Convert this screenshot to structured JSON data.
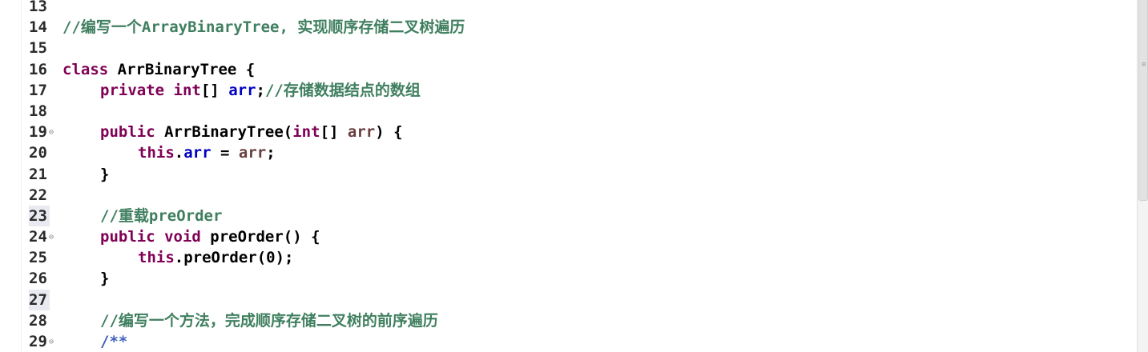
{
  "editor": {
    "lines": [
      {
        "num": "13",
        "tokens": []
      },
      {
        "num": "14",
        "tokens": [
          {
            "t": "//编写一个ArrayBinaryTree, 实现顺序存储二叉树遍历",
            "c": "cmt"
          }
        ]
      },
      {
        "num": "15",
        "tokens": []
      },
      {
        "num": "16",
        "tokens": [
          {
            "t": "class",
            "c": "kw"
          },
          {
            "t": " ArrBinaryTree {",
            "c": ""
          }
        ]
      },
      {
        "num": "17",
        "indent": 1,
        "tokens": [
          {
            "t": "private",
            "c": "kw"
          },
          {
            "t": " ",
            "c": ""
          },
          {
            "t": "int",
            "c": "kw"
          },
          {
            "t": "[] ",
            "c": ""
          },
          {
            "t": "arr",
            "c": "fld"
          },
          {
            "t": ";",
            "c": ""
          },
          {
            "t": "//存储数据结点的数组",
            "c": "cmt"
          }
        ]
      },
      {
        "num": "18",
        "tokens": []
      },
      {
        "num": "19",
        "fold": true,
        "indent": 1,
        "tokens": [
          {
            "t": "public",
            "c": "kw"
          },
          {
            "t": " ArrBinaryTree(",
            "c": ""
          },
          {
            "t": "int",
            "c": "kw"
          },
          {
            "t": "[] ",
            "c": ""
          },
          {
            "t": "arr",
            "c": "par"
          },
          {
            "t": ") {",
            "c": ""
          }
        ]
      },
      {
        "num": "20",
        "indent": 2,
        "tokens": [
          {
            "t": "this",
            "c": "kw"
          },
          {
            "t": ".",
            "c": ""
          },
          {
            "t": "arr",
            "c": "fld"
          },
          {
            "t": " = ",
            "c": ""
          },
          {
            "t": "arr",
            "c": "par"
          },
          {
            "t": ";",
            "c": ""
          }
        ]
      },
      {
        "num": "21",
        "indent": 1,
        "tokens": [
          {
            "t": "}",
            "c": ""
          }
        ]
      },
      {
        "num": "22",
        "tokens": []
      },
      {
        "num": "23",
        "hl": true,
        "indent": 1,
        "tokens": [
          {
            "t": "//重载preOrder",
            "c": "cmt"
          }
        ]
      },
      {
        "num": "24",
        "fold": true,
        "indent": 1,
        "tokens": [
          {
            "t": "public",
            "c": "kw"
          },
          {
            "t": " ",
            "c": ""
          },
          {
            "t": "void",
            "c": "kw"
          },
          {
            "t": " preOrder() {",
            "c": ""
          }
        ]
      },
      {
        "num": "25",
        "indent": 2,
        "tokens": [
          {
            "t": "this",
            "c": "kw"
          },
          {
            "t": ".preOrder(0);",
            "c": ""
          }
        ]
      },
      {
        "num": "26",
        "indent": 1,
        "tokens": [
          {
            "t": "}",
            "c": ""
          }
        ]
      },
      {
        "num": "27",
        "hl": true,
        "tokens": []
      },
      {
        "num": "28",
        "indent": 1,
        "tokens": [
          {
            "t": "//编写一个方法，完成顺序存储二叉树的前序遍历",
            "c": "cmt"
          }
        ]
      },
      {
        "num": "29",
        "fold": true,
        "indent": 1,
        "tokens": [
          {
            "t": "/**",
            "c": "doc"
          }
        ]
      }
    ]
  },
  "icons": {
    "fold": "fold-collapse-icon",
    "grip": "scroll-grip-icon"
  },
  "colors": {
    "keyword": "#7f0055",
    "field": "#0000c0",
    "parameter": "#6a3e3e",
    "comment": "#3f7f5f",
    "javadoc": "#3f5fbf"
  }
}
